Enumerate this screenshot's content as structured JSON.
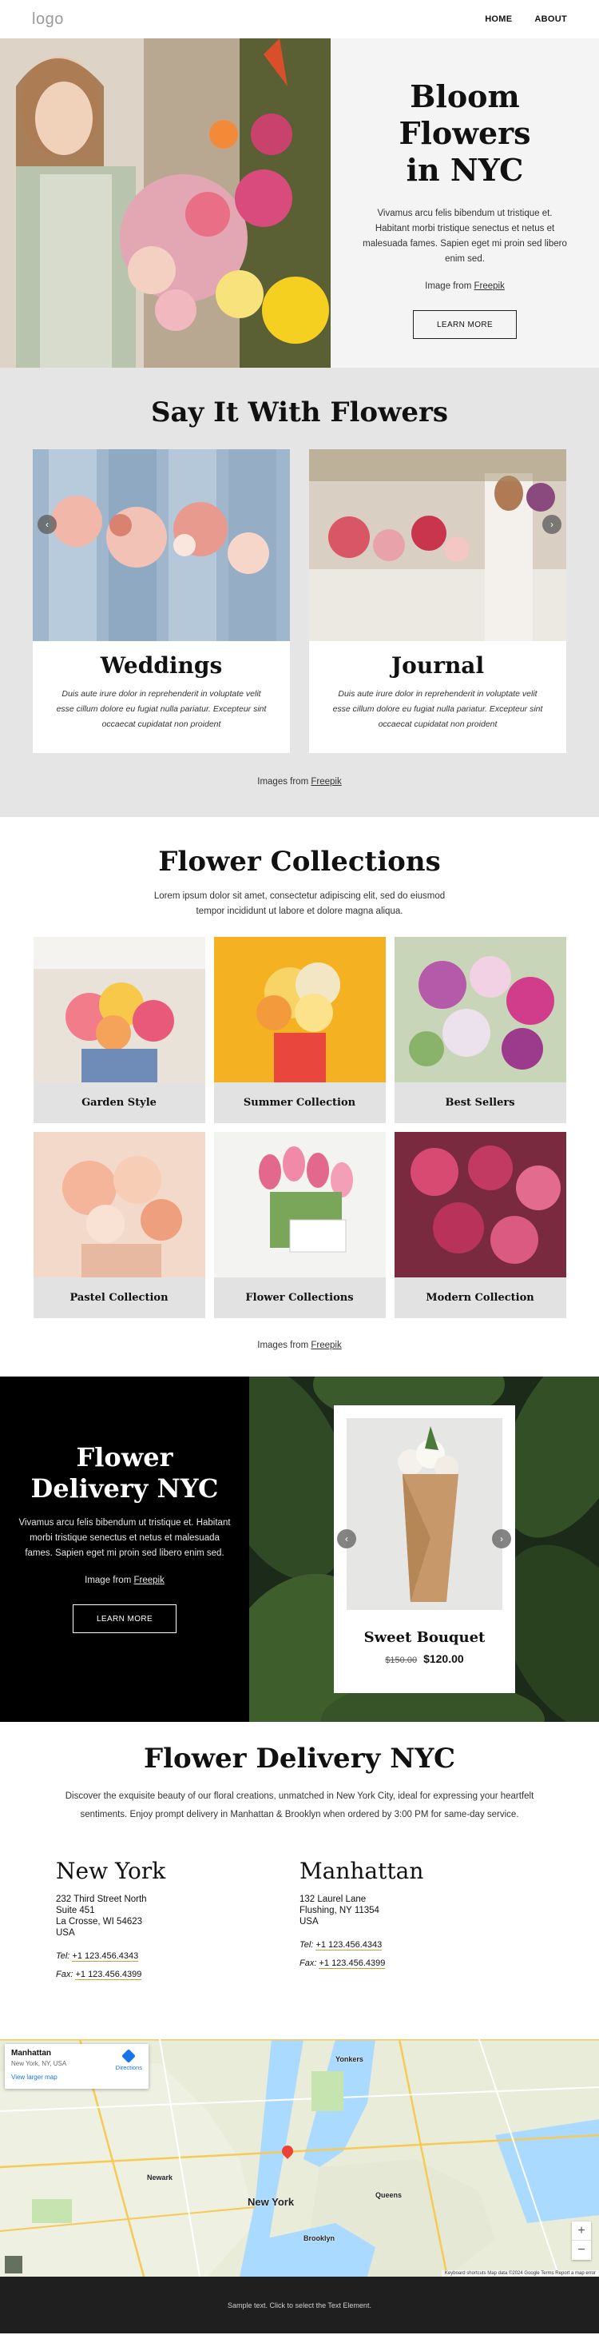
{
  "header": {
    "logo": "logo",
    "nav": [
      "HOME",
      "ABOUT"
    ]
  },
  "hero": {
    "title_lines": [
      "Bloom",
      "Flowers",
      "in NYC"
    ],
    "body": "Vivamus arcu felis bibendum ut tristique et. Habitant morbi tristique senectus et netus et malesuada fames. Sapien eget mi proin sed libero enim sed.",
    "credit_prefix": "Image from",
    "credit_link": "Freepik",
    "button": "LEARN MORE"
  },
  "say": {
    "title": "Say It With Flowers",
    "cards": [
      {
        "title": "Weddings",
        "text": "Duis aute irure dolor in reprehenderit in voluptate velit esse cillum dolore eu fugiat nulla pariatur. Excepteur sint occaecat cupidatat non proident"
      },
      {
        "title": "Journal",
        "text": "Duis aute irure dolor in reprehenderit in voluptate velit esse cillum dolore eu fugiat nulla pariatur. Excepteur sint occaecat cupidatat non proident"
      }
    ],
    "credit_prefix": "Images from",
    "credit_link": "Freepik",
    "arrow_left": "‹",
    "arrow_right": "›"
  },
  "collections": {
    "title": "Flower Collections",
    "subtitle": "Lorem ipsum dolor sit amet, consectetur adipiscing elit, sed do eiusmod tempor incididunt ut labore et dolore magna aliqua.",
    "items": [
      "Garden Style",
      "Summer Collection",
      "Best Sellers",
      "Pastel Collection",
      "Flower Collections",
      "Modern Collection"
    ],
    "credit_prefix": "Images from",
    "credit_link": "Freepik"
  },
  "delivery": {
    "title_lines": [
      "Flower",
      "Delivery NYC"
    ],
    "body": "Vivamus arcu felis bibendum ut tristique et. Habitant morbi tristique senectus et netus et malesuada fames. Sapien eget mi proin sed libero enim sed.",
    "credit_prefix": "Image from",
    "credit_link": "Freepik",
    "button": "LEARN MORE",
    "product": {
      "name": "Sweet Bouquet",
      "old_price": "$150.00",
      "new_price": "$120.00"
    },
    "arrow_left": "‹",
    "arrow_right": "›"
  },
  "info": {
    "title": "Flower Delivery NYC",
    "text": "Discover the exquisite beauty of our floral creations, unmatched in New York City, ideal for expressing your heartfelt sentiments. Enjoy prompt delivery in Manhattan & Brooklyn when ordered by 3:00 PM for same-day service.",
    "locations": [
      {
        "name": "New York",
        "lines": [
          "232 Third Street North",
          "Suite 451",
          "La Crosse, WI 54623",
          "USA"
        ],
        "tel_label": "Tel:",
        "tel": "+1 123.456.4343",
        "fax_label": "Fax:",
        "fax": "+1 123.456.4399"
      },
      {
        "name": "Manhattan",
        "lines": [
          "132 Laurel Lane",
          "Flushing, NY 11354",
          "USA"
        ],
        "tel_label": "Tel:",
        "tel": "+1 123.456.4343",
        "fax_label": "Fax:",
        "fax": "+1 123.456.4399"
      }
    ]
  },
  "map": {
    "card_title": "Manhattan",
    "card_sub": "New York, NY, USA",
    "card_link": "View larger map",
    "directions": "Directions",
    "labels": [
      "New York",
      "Newark",
      "Brooklyn",
      "Queens",
      "Yonkers"
    ],
    "zoom_in": "+",
    "zoom_out": "−",
    "footer": "Keyboard shortcuts   Map data ©2024 Google   Terms   Report a map error"
  },
  "footer": {
    "text": "Sample text. Click to select the Text Element."
  },
  "colors": {
    "accent_underline": "#c9a13a",
    "section_gray": "#e5e5e5",
    "dark": "#000000"
  }
}
